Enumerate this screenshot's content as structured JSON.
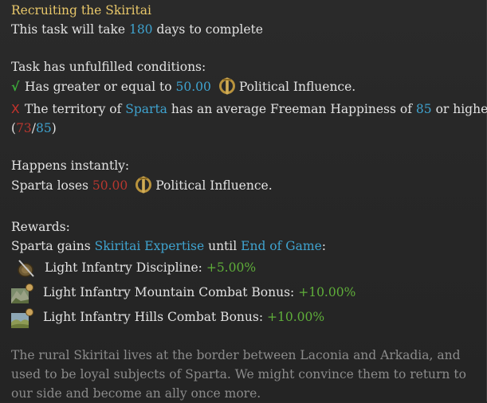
{
  "title": "Recruiting the Skiritai",
  "duration": {
    "prefix": "This task will take",
    "days": "180",
    "suffix": "days to complete"
  },
  "conditions": {
    "header": "Task has unfulfilled conditions:",
    "items": [
      {
        "status": "met",
        "mark": "√",
        "text_a": "Has greater or equal to",
        "value": "50.00",
        "text_b": "Political Influence."
      },
      {
        "status": "unmet",
        "mark": "X",
        "text_a": "The territory of",
        "place": "Sparta",
        "text_b": "has an average Freeman Happiness of",
        "value": "85",
        "text_c": "or higher.",
        "progress_open": "(",
        "current": "73",
        "sep": "/",
        "target": "85",
        "progress_close": ")"
      }
    ]
  },
  "instant": {
    "header": "Happens instantly:",
    "text_a": "Sparta loses",
    "value": "50.00",
    "text_b": "Political Influence."
  },
  "rewards": {
    "header": "Rewards:",
    "text_a": "Sparta gains",
    "modifier": "Skiritai Expertise",
    "text_b": "until",
    "duration": "End of Game",
    "colon": ":",
    "items": [
      {
        "icon": "shield-icon",
        "label": "Light Infantry Discipline:",
        "value": "+5.00%"
      },
      {
        "icon": "mountain-icon",
        "label": "Light Infantry Mountain Combat Bonus:",
        "value": "+10.00%"
      },
      {
        "icon": "hills-icon",
        "label": "Light Infantry Hills Combat Bonus:",
        "value": "+10.00%"
      }
    ]
  },
  "description": "The rural Skiritai lives at the border between Laconia and Arkadia, and used to be loyal subjects of Sparta. We might convince them to return to our side and become an ally once more.",
  "colors": {
    "title": "#e8c76a",
    "highlight": "#3fa3cf",
    "negative": "#b8372f",
    "positive": "#5fae3a",
    "description": "#8b8b8b"
  }
}
